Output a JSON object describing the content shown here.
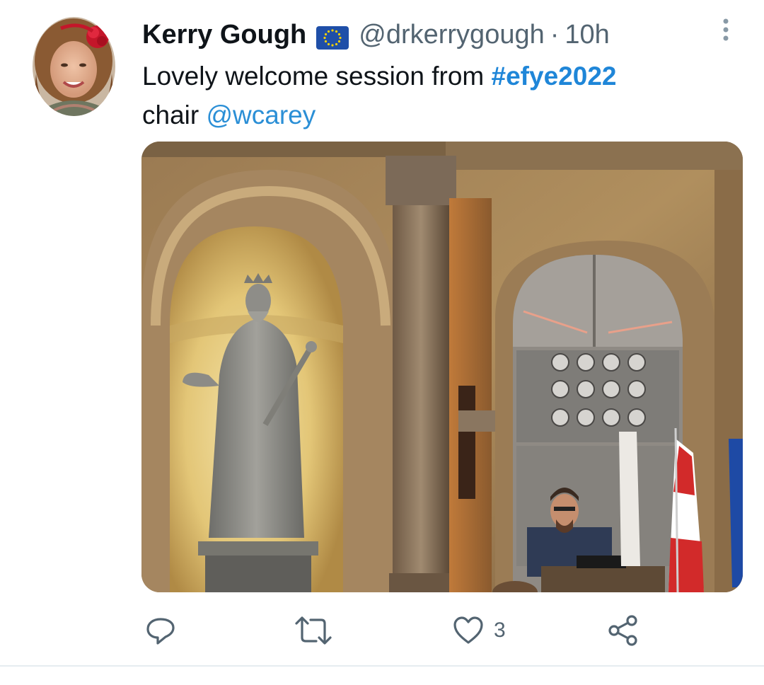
{
  "tweet": {
    "author_name": "Kerry Gough",
    "handle": "@drkerrygough",
    "separator": "·",
    "time": "10h",
    "text_before_hashtag": "Lovely welcome session from ",
    "hashtag": "#efye2022",
    "text_between": "chair ",
    "mention": "@wcarey",
    "like_count": "3"
  },
  "icons": {
    "more": "more-vertical-icon",
    "reply": "reply-icon",
    "retweet": "retweet-icon",
    "like": "heart-icon",
    "share": "share-icon",
    "flag": "eu-flag-icon"
  },
  "colors": {
    "link": "#1d9bf0",
    "text": "#0f1419",
    "muted": "#536471"
  }
}
